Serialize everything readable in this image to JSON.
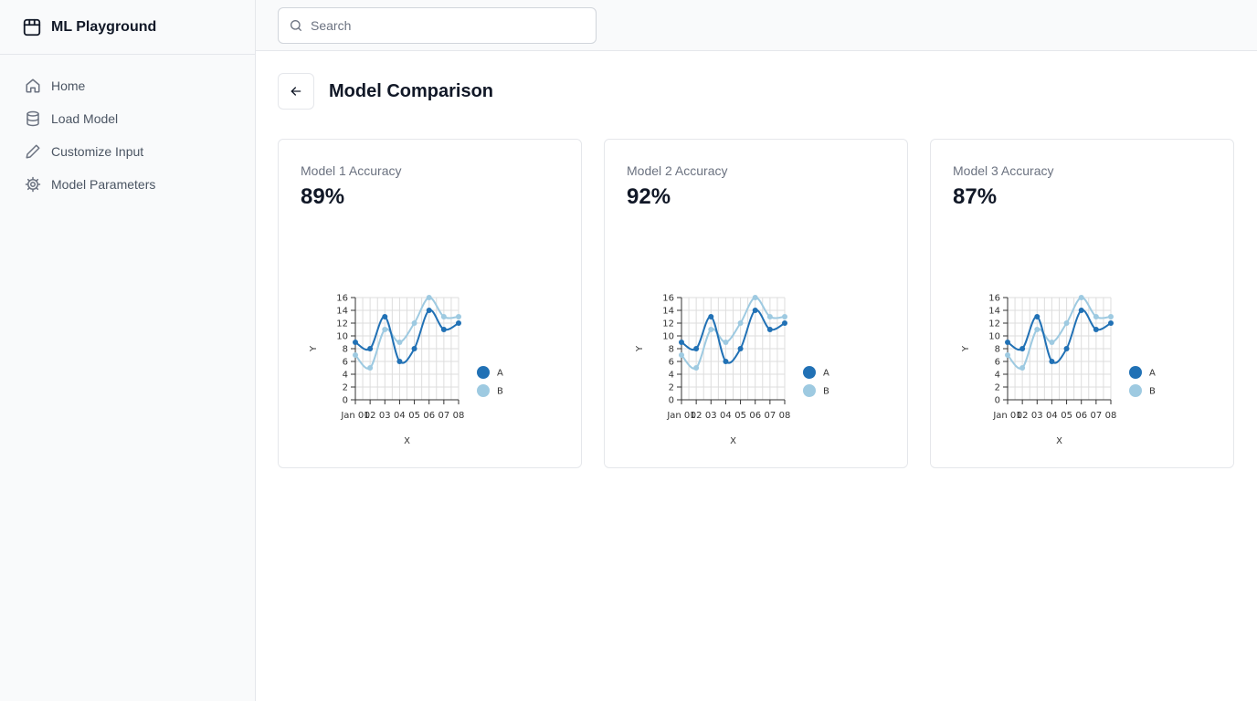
{
  "app": {
    "name": "ML Playground"
  },
  "sidebar": {
    "items": [
      {
        "label": "Home",
        "icon": "home-icon"
      },
      {
        "label": "Load Model",
        "icon": "database-icon"
      },
      {
        "label": "Customize Input",
        "icon": "pencil-icon"
      },
      {
        "label": "Model Parameters",
        "icon": "gear-icon"
      }
    ]
  },
  "search": {
    "placeholder": "Search",
    "value": ""
  },
  "page": {
    "title": "Model Comparison",
    "back_icon": "arrow-left-icon"
  },
  "cards": [
    {
      "label": "Model 1 Accuracy",
      "value": "89%"
    },
    {
      "label": "Model 2 Accuracy",
      "value": "92%"
    },
    {
      "label": "Model 3 Accuracy",
      "value": "87%"
    }
  ],
  "colors": {
    "series_a": "#2171b5",
    "series_b": "#9ecae1",
    "grid": "#dddddd"
  },
  "chart_data": [
    {
      "type": "line",
      "x": [
        "Jan 01",
        "Jan 02",
        "Jan 03",
        "Jan 04",
        "Jan 05",
        "Jan 06",
        "Jan 07",
        "Jan 08"
      ],
      "x_tick_labels": [
        "Jan 01",
        "02",
        "03",
        "04",
        "05",
        "06",
        "07",
        "08"
      ],
      "series": [
        {
          "name": "A",
          "values": [
            9,
            8,
            13,
            6,
            8,
            14,
            11,
            12
          ]
        },
        {
          "name": "B",
          "values": [
            7,
            5,
            11,
            9,
            12,
            16,
            13,
            13
          ]
        }
      ],
      "xlabel": "X",
      "ylabel": "Y",
      "ylim": [
        0,
        16
      ],
      "y_ticks": [
        0,
        2,
        4,
        6,
        8,
        10,
        12,
        14,
        16
      ],
      "grid": true,
      "legend": "right"
    },
    {
      "type": "line",
      "x": [
        "Jan 01",
        "Jan 02",
        "Jan 03",
        "Jan 04",
        "Jan 05",
        "Jan 06",
        "Jan 07",
        "Jan 08"
      ],
      "x_tick_labels": [
        "Jan 01",
        "02",
        "03",
        "04",
        "05",
        "06",
        "07",
        "08"
      ],
      "series": [
        {
          "name": "A",
          "values": [
            9,
            8,
            13,
            6,
            8,
            14,
            11,
            12
          ]
        },
        {
          "name": "B",
          "values": [
            7,
            5,
            11,
            9,
            12,
            16,
            13,
            13
          ]
        }
      ],
      "xlabel": "X",
      "ylabel": "Y",
      "ylim": [
        0,
        16
      ],
      "y_ticks": [
        0,
        2,
        4,
        6,
        8,
        10,
        12,
        14,
        16
      ],
      "grid": true,
      "legend": "right"
    },
    {
      "type": "line",
      "x": [
        "Jan 01",
        "Jan 02",
        "Jan 03",
        "Jan 04",
        "Jan 05",
        "Jan 06",
        "Jan 07",
        "Jan 08"
      ],
      "x_tick_labels": [
        "Jan 01",
        "02",
        "03",
        "04",
        "05",
        "06",
        "07",
        "08"
      ],
      "series": [
        {
          "name": "A",
          "values": [
            9,
            8,
            13,
            6,
            8,
            14,
            11,
            12
          ]
        },
        {
          "name": "B",
          "values": [
            7,
            5,
            11,
            9,
            12,
            16,
            13,
            13
          ]
        }
      ],
      "xlabel": "X",
      "ylabel": "Y",
      "ylim": [
        0,
        16
      ],
      "y_ticks": [
        0,
        2,
        4,
        6,
        8,
        10,
        12,
        14,
        16
      ],
      "grid": true,
      "legend": "right"
    }
  ]
}
